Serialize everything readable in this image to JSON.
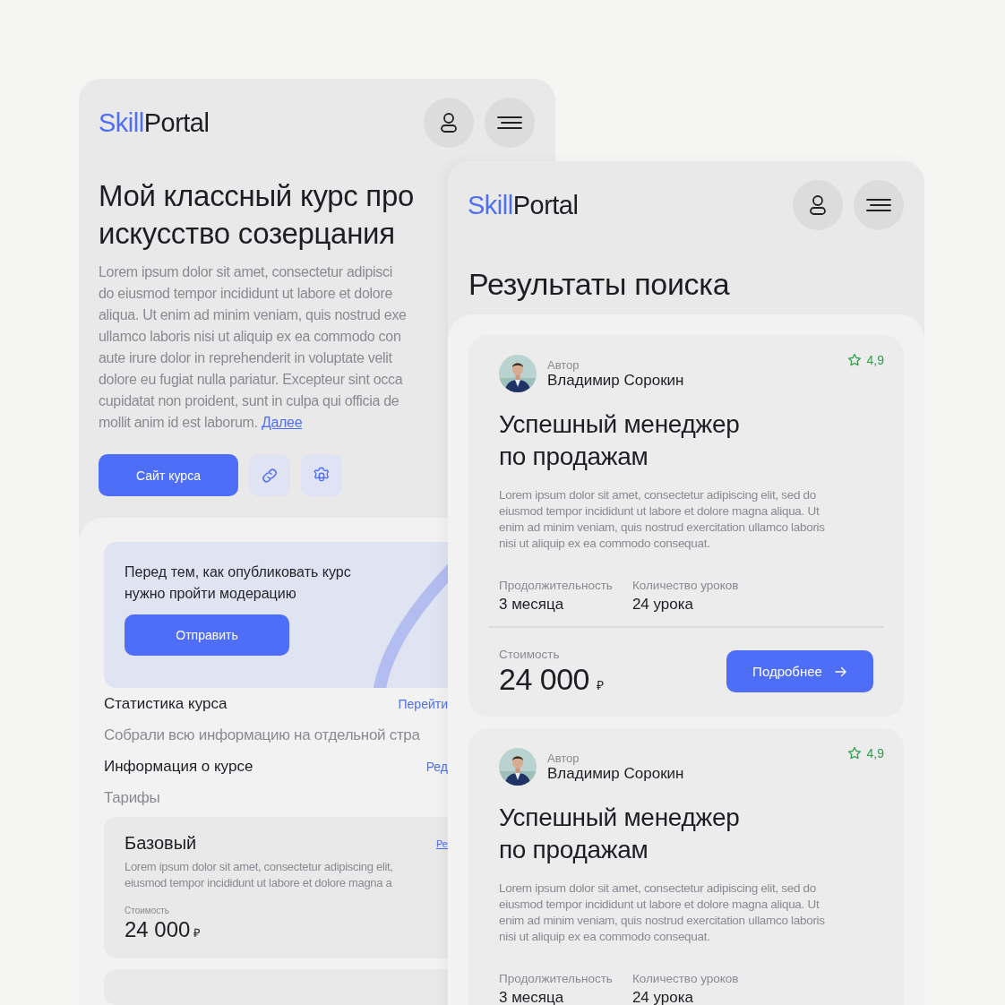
{
  "back_screen": {
    "logo": {
      "accent": "Skill",
      "rest": "Portal"
    },
    "title_lines": [
      "Мой классный курс про",
      "искусство созерцания"
    ],
    "description": {
      "lines": [
        "Lorem ipsum dolor sit amet, consectetur adipisci",
        "do eiusmod tempor incididunt ut labore et dolore",
        "aliqua. Ut enim ad minim veniam, quis nostrud exe",
        "ullamco laboris nisi ut aliquip ex ea commodo con",
        "aute irure dolor in reprehenderit in voluptate velit",
        "dolore eu fugiat nulla pariatur. Excepteur sint occa",
        "cupidatat non proident, sunt in culpa qui officia de",
        "mollit anim id est laborum."
      ],
      "link": "Далее"
    },
    "primary_button": "Сайт курса",
    "moderation": {
      "text": "Перед тем, как опубликовать курс нужно пройти модерацию",
      "button": "Отправить"
    },
    "rows": [
      {
        "kind": "heading",
        "label": "Статистика курса",
        "link": "Перейти"
      },
      {
        "kind": "note",
        "label": "Собрали всю информацию на отдельной стра"
      },
      {
        "kind": "heading",
        "label": "Информация о курсе",
        "link": "Ред"
      },
      {
        "kind": "note",
        "label": "Тарифы"
      }
    ],
    "tariff": {
      "name": "Базовый",
      "link": "Ре",
      "description": "Lorem ipsum dolor sit amet, consectetur adipiscing elit, eiusmod tempor incididunt ut labore et dolore magna a",
      "price_label": "Стоимость",
      "price": "24 000",
      "currency": "₽"
    }
  },
  "front_screen": {
    "logo": {
      "accent": "Skill",
      "rest": "Portal"
    },
    "title": "Результаты поиска",
    "cards": [
      {
        "author_label": "Автор",
        "author": "Владимир Сорокин",
        "rating": "4,9",
        "title": "Успешный менеджер по продажам",
        "description": "Lorem ipsum dolor sit amet, consectetur adipiscing elit, sed do eiusmod tempor incididunt ut labore et dolore magna aliqua. Ut enim ad minim veniam, quis nostrud exercitation ullamco laboris nisi ut aliquip ex ea commodo consequat.",
        "stats": [
          {
            "label": "Продолжительность",
            "value": "3 месяца"
          },
          {
            "label": "Количество уроков",
            "value": "24 урока"
          }
        ],
        "price_label": "Стоимость",
        "price": "24 000",
        "currency": "₽",
        "button": "Подробнее"
      },
      {
        "author_label": "Автор",
        "author": "Владимир Сорокин",
        "rating": "4,9",
        "title": "Успешный менеджер по продажам",
        "description": "Lorem ipsum dolor sit amet, consectetur adipiscing elit, sed do eiusmod tempor incididunt ut labore et dolore magna aliqua. Ut enim ad minim veniam, quis nostrud exercitation ullamco laboris nisi ut aliquip ex ea commodo consequat.",
        "stats": [
          {
            "label": "Продолжительность",
            "value": "3 месяца"
          },
          {
            "label": "Количество уроков",
            "value": "24 урока"
          }
        ]
      }
    ]
  }
}
